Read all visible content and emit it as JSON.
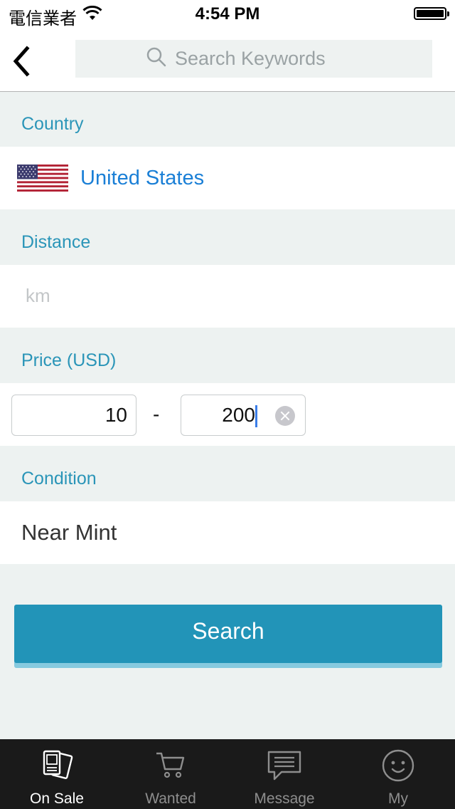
{
  "status_bar": {
    "carrier": "電信業者",
    "time": "4:54 PM"
  },
  "search": {
    "placeholder": "Search Keywords",
    "value": ""
  },
  "country": {
    "label": "Country",
    "value": "United States",
    "flag_icon": "us-flag-icon"
  },
  "distance": {
    "label": "Distance",
    "placeholder": "km",
    "value": ""
  },
  "price": {
    "label": "Price (USD)",
    "min": "10",
    "separator": "-",
    "max": "200"
  },
  "condition": {
    "label": "Condition",
    "value": "Near Mint"
  },
  "search_button": {
    "label": "Search"
  },
  "tabs": [
    {
      "label": "On Sale",
      "icon": "cards-icon",
      "active": true
    },
    {
      "label": "Wanted",
      "icon": "cart-icon",
      "active": false
    },
    {
      "label": "Message",
      "icon": "message-icon",
      "active": false
    },
    {
      "label": "My",
      "icon": "smiley-icon",
      "active": false
    }
  ],
  "colors": {
    "accent": "#2294b8",
    "section_label": "#2a95b8",
    "link_blue": "#1a7fd6",
    "background": "#edf2f1",
    "tabbar": "#1a1a1a"
  }
}
